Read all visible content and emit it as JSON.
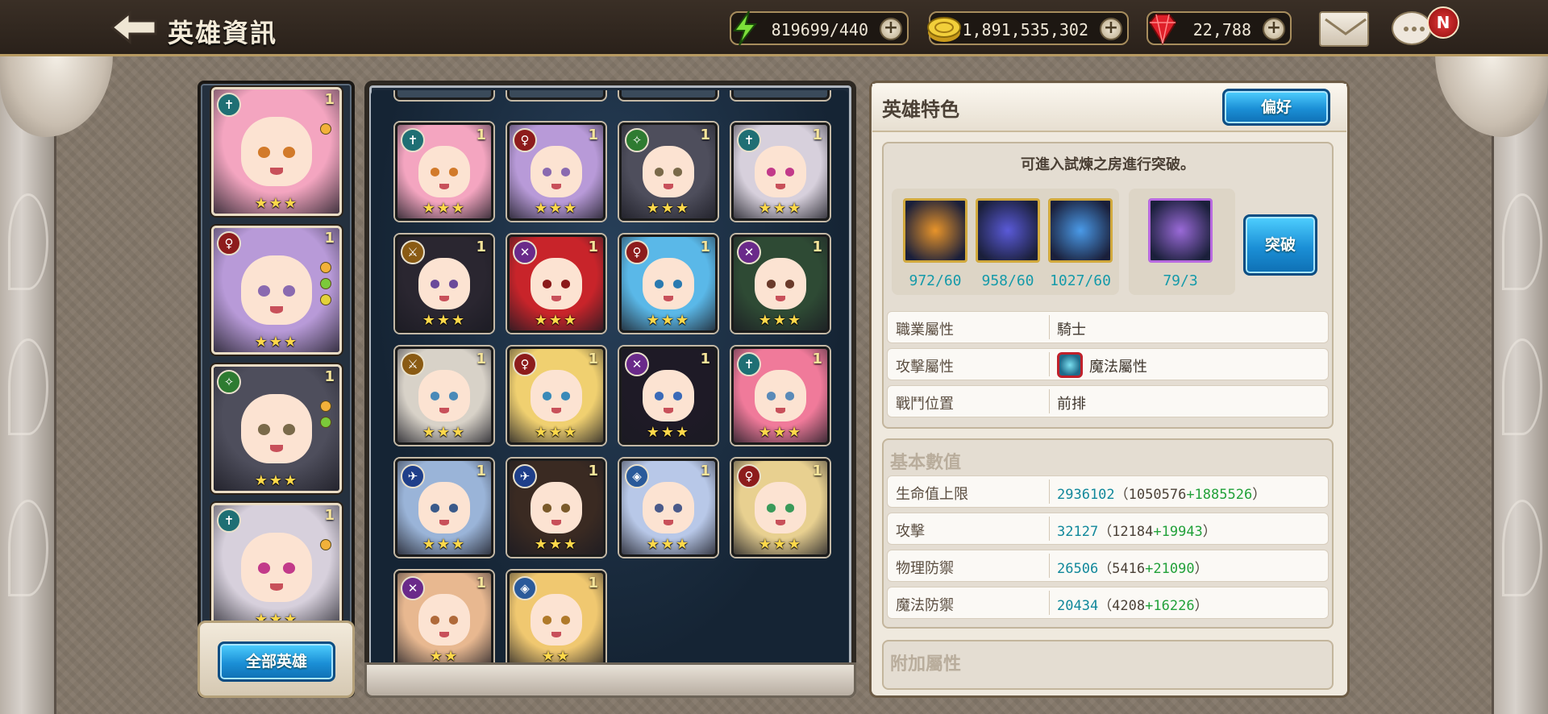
{
  "header": {
    "title": "英雄資訊",
    "resources": {
      "energy": "819699/440",
      "gold": "1,891,535,302",
      "gems": "22,788"
    },
    "notification_badge": "N"
  },
  "team_panel": {
    "all_heroes_button": "全部英雄",
    "cards": [
      {
        "badge": "✝",
        "badge_color": "#1f6f74",
        "level": "1",
        "stars": "★★★",
        "hair": "#f4a5c0",
        "eyes": "#d27a2a",
        "dots": [
          "#f2b13a"
        ]
      },
      {
        "badge": "♀",
        "badge_color": "#8d1c1c",
        "level": "1",
        "stars": "★★★",
        "hair": "#b89ad8",
        "eyes": "#8a6ab0",
        "dots": [
          "#f2b13a",
          "#7bc93a",
          "#e3d23a"
        ]
      },
      {
        "badge": "✧",
        "badge_color": "#2e7b31",
        "level": "1",
        "stars": "★★★",
        "hair": "#4e4e5c",
        "eyes": "#7a6a4a",
        "dots": [
          "#f2b13a",
          "#7bc93a"
        ]
      },
      {
        "badge": "✝",
        "badge_color": "#1f6f74",
        "level": "1",
        "stars": "★★★",
        "hair": "#d7d0dc",
        "eyes": "#c23a8a",
        "dots": [
          "#f2b13a"
        ]
      }
    ]
  },
  "hero_grid": {
    "cards": [
      {
        "badge": "✝",
        "badge_color": "#1f6f74",
        "level": "1",
        "stars": "★★★",
        "hair": "#f4a5c0",
        "eyes": "#d27a2a"
      },
      {
        "badge": "♀",
        "badge_color": "#8d1c1c",
        "level": "1",
        "stars": "★★★",
        "hair": "#b89ad8",
        "eyes": "#8a6ab0"
      },
      {
        "badge": "✧",
        "badge_color": "#2e7b31",
        "level": "1",
        "stars": "★★★",
        "hair": "#4e4e5c",
        "eyes": "#7a6a4a"
      },
      {
        "badge": "✝",
        "badge_color": "#1f6f74",
        "level": "1",
        "stars": "★★★",
        "hair": "#d7d0dc",
        "eyes": "#c23a8a"
      },
      {
        "badge": "⚔",
        "badge_color": "#8a5b14",
        "level": "1",
        "stars": "★★★",
        "hair": "#2a2630",
        "eyes": "#6a4a9a"
      },
      {
        "badge": "✕",
        "badge_color": "#6a2a8a",
        "level": "1",
        "stars": "★★★",
        "hair": "#c8242a",
        "eyes": "#8a1a1a"
      },
      {
        "badge": "♀",
        "badge_color": "#8d1c1c",
        "level": "1",
        "stars": "★★★",
        "hair": "#5ab8e8",
        "eyes": "#2a7ab0"
      },
      {
        "badge": "✕",
        "badge_color": "#6a2a8a",
        "level": "1",
        "stars": "★★★",
        "hair": "#2e4a34",
        "eyes": "#6a3a2a"
      },
      {
        "badge": "⚔",
        "badge_color": "#8a5b14",
        "level": "1",
        "stars": "★★★",
        "hair": "#d8d2c8",
        "eyes": "#4a8ab8"
      },
      {
        "badge": "♀",
        "badge_color": "#8d1c1c",
        "level": "1",
        "stars": "★★★",
        "hair": "#f0d070",
        "eyes": "#3a8ab8"
      },
      {
        "badge": "✕",
        "badge_color": "#6a2a8a",
        "level": "1",
        "stars": "★★★",
        "hair": "#1e1a26",
        "eyes": "#3a6ab8"
      },
      {
        "badge": "✝",
        "badge_color": "#1f6f74",
        "level": "1",
        "stars": "★★★",
        "hair": "#f07a9a",
        "eyes": "#5a8ab8"
      },
      {
        "badge": "✈",
        "badge_color": "#1f3f8a",
        "level": "1",
        "stars": "★★★",
        "hair": "#9ab4d8",
        "eyes": "#3a5a8a"
      },
      {
        "badge": "✈",
        "badge_color": "#1f3f8a",
        "level": "1",
        "stars": "★★★",
        "hair": "#3a2a22",
        "eyes": "#7a5a2a"
      },
      {
        "badge": "◈",
        "badge_color": "#2a5a9a",
        "level": "1",
        "stars": "★★★",
        "hair": "#b8c8e8",
        "eyes": "#4a5a8a"
      },
      {
        "badge": "♀",
        "badge_color": "#8d1c1c",
        "level": "1",
        "stars": "★★★",
        "hair": "#e8d090",
        "eyes": "#3a9a5a"
      },
      {
        "badge": "✕",
        "badge_color": "#6a2a8a",
        "level": "1",
        "stars": "★★",
        "hair": "#e8b890",
        "eyes": "#b06a3a"
      },
      {
        "badge": "◈",
        "badge_color": "#2a5a9a",
        "level": "1",
        "stars": "★★",
        "hair": "#f0c870",
        "eyes": "#b07a2a"
      }
    ]
  },
  "info": {
    "title": "英雄特色",
    "preference_button": "偏好",
    "breakthrough_hint": "可進入試煉之房進行突破。",
    "breakthrough_button": "突破",
    "materials": [
      {
        "count": "972/60",
        "color": "#e8942a",
        "icon": "flame-crystal-icon"
      },
      {
        "count": "958/60",
        "color": "#5a5ad8",
        "icon": "violet-flower-icon"
      },
      {
        "count": "1027/60",
        "color": "#4a9ae8",
        "icon": "ice-crystal-icon"
      },
      {
        "count": "79/3",
        "color": "#9a6ad8",
        "icon": "star-gem-icon"
      }
    ],
    "attributes": [
      {
        "key": "職業屬性",
        "value": "騎士"
      },
      {
        "key": "攻擊屬性",
        "value": "魔法屬性"
      },
      {
        "key": "戰鬥位置",
        "value": "前排"
      }
    ],
    "base_stats_title": "基本數值",
    "stats": [
      {
        "key": "生命值上限",
        "total": "2936102",
        "base": "（1050576",
        "bonus": "+1885526",
        "close": "）"
      },
      {
        "key": "攻擊",
        "total": "32127",
        "base": "（12184",
        "bonus": "+19943",
        "close": "）"
      },
      {
        "key": "物理防禦",
        "total": "26506",
        "base": "（5416",
        "bonus": "+21090",
        "close": "）"
      },
      {
        "key": "魔法防禦",
        "total": "20434",
        "base": "（4208",
        "bonus": "+16226",
        "close": "）"
      }
    ],
    "extra_title": "附加屬性"
  }
}
